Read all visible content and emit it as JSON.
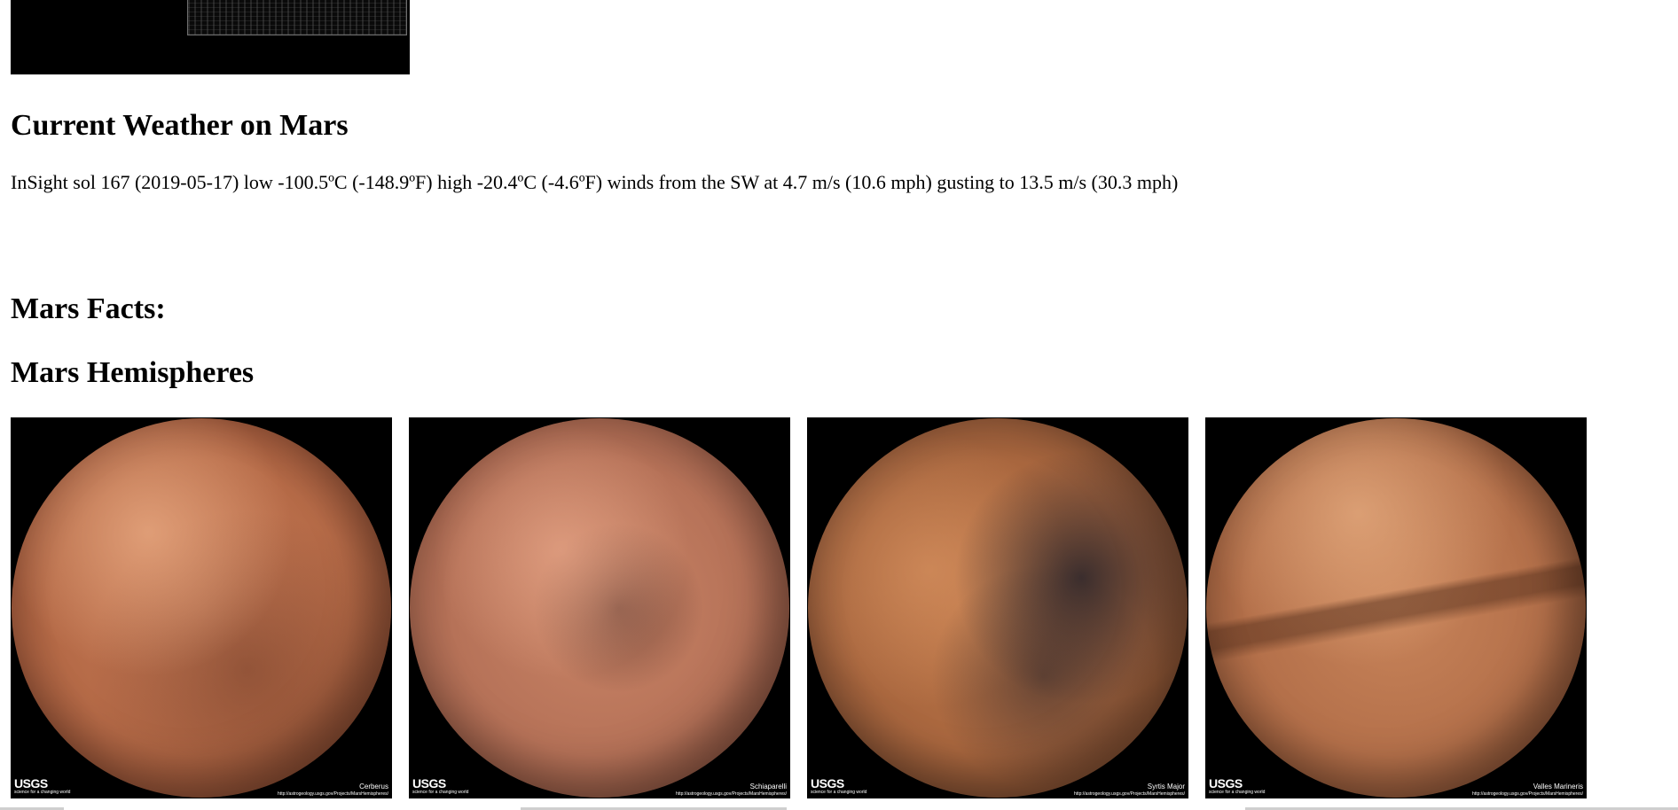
{
  "weather": {
    "heading": "Current Weather on Mars",
    "text": "InSight sol 167 (2019-05-17) low -100.5ºC (-148.9ºF) high -20.4ºC (-4.6ºF) winds from the SW at 4.7 m/s (10.6 mph) gusting to 13.5 m/s (30.3 mph)"
  },
  "facts": {
    "heading": "Mars Facts:"
  },
  "hemispheres": {
    "heading": "Mars Hemispheres",
    "logo_text": "USGS",
    "logo_tagline": "science for a changing world",
    "items": [
      {
        "title": "Cerberus",
        "url": "http://astrogeology.usgs.gov/Projects/MarsHemispheres/"
      },
      {
        "title": "Schiaparelli",
        "url": "http://astrogeology.usgs.gov/Projects/MarsHemispheres/"
      },
      {
        "title": "Syrtis Major",
        "url": "http://astrogeology.usgs.gov/Projects/MarsHemispheres/"
      },
      {
        "title": "Valles Marineris",
        "url": "http://astrogeology.usgs.gov/Projects/MarsHemispheres/"
      }
    ]
  },
  "colors": {
    "page_background": "#ffffff",
    "image_background": "#000000",
    "text": "#000000",
    "mars_surface": "#b56a47"
  }
}
